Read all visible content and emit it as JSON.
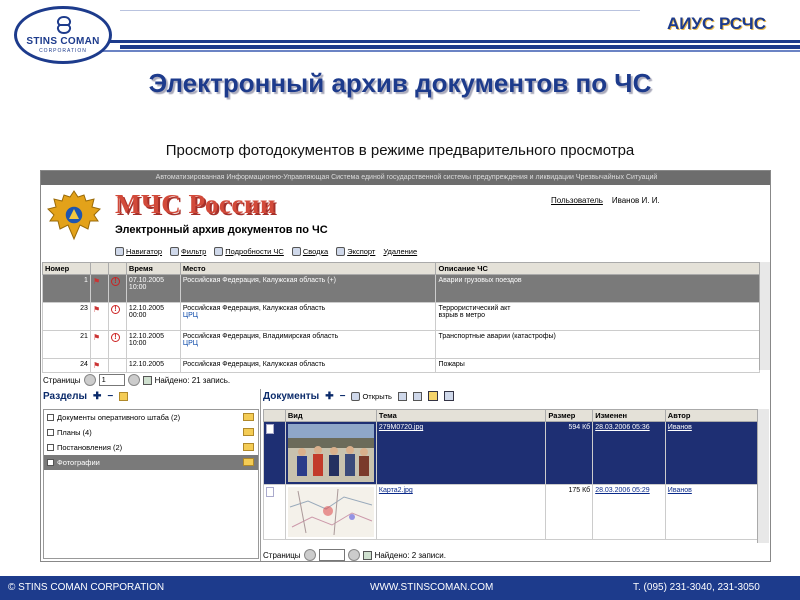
{
  "header": {
    "logo_name": "STINS COMAN",
    "logo_sub": "CORPORATION",
    "brand": "АИУС РСЧС",
    "title": "Электронный архив документов по ЧС",
    "subtitle": "Просмотр фотодокументов в режиме предварительного просмотра"
  },
  "app": {
    "banner": "Автоматизированная Информационно-Управляющая Система единой государственной системы предупреждения и ликвидации Чрезвычайных Ситуаций",
    "logo_text": "МЧС России",
    "title": "Электронный архив документов по ЧС",
    "user_label": "Пользователь",
    "user_name": "Иванов И. И.",
    "toolbar": [
      "Навигатор",
      "Фильтр",
      "Подробности ЧС",
      "Сводка",
      "Экспорт",
      "Удаление"
    ],
    "grid": {
      "columns": [
        "Номер",
        "",
        "",
        "Время",
        "Место",
        "Описание ЧС"
      ],
      "rows": [
        {
          "num": "1",
          "date": "07.10.2005",
          "time": "10:00",
          "place": "Российская Федерация, Калужская область (+)",
          "place2": "",
          "desc": "Аварии грузовых поездов",
          "desc2": ""
        },
        {
          "num": "23",
          "date": "12.10.2005",
          "time": "00:00",
          "place": "Российская Федерация, Калужская область",
          "place2": "ЦРЦ",
          "desc": "Террористический акт",
          "desc2": "взрыв в метро"
        },
        {
          "num": "21",
          "date": "12.10.2005",
          "time": "10:00",
          "place": "Российская Федерация, Владимирская область",
          "place2": "ЦРЦ",
          "desc": "Транспортные аварии (катастрофы)",
          "desc2": ""
        },
        {
          "num": "24",
          "date": "12.10.2005",
          "time": "",
          "place": "Российская Федерация, Калужская область",
          "place2": "",
          "desc": "Пожары",
          "desc2": ""
        }
      ]
    },
    "pager1": {
      "label": "Страницы",
      "page": "1",
      "found": "Найдено: 21 запись."
    },
    "sections": {
      "title": "Разделы",
      "items": [
        "Документы оперативного штаба (2)",
        "Планы (4)",
        "Постановления (2)",
        "Фотографии"
      ]
    },
    "documents": {
      "title": "Документы",
      "open": "Открыть",
      "columns": [
        "Вид",
        "Тема",
        "Размер",
        "Изменен",
        "Автор"
      ],
      "rows": [
        {
          "topic": "279M0720.jpg",
          "size": "594 Кб",
          "modified": "28.03.2006 05:36",
          "author": "Иванов"
        },
        {
          "topic": "Карта2.jpg",
          "size": "175 Кб",
          "modified": "28.03.2006 05:29",
          "author": "Иванов"
        }
      ]
    },
    "pager2": {
      "label": "Страницы",
      "found": "Найдено: 2 записи."
    }
  },
  "footer": {
    "left": "© STINS COMAN CORPORATION",
    "center": "WWW.STINSCOMAN.COM",
    "right": "Т. (095) 231-3040, 231-3050"
  },
  "colors": {
    "brand_blue": "#1d3b8c",
    "selected_dark": "#1e2f73",
    "mchs_red": "#d24a3a"
  }
}
